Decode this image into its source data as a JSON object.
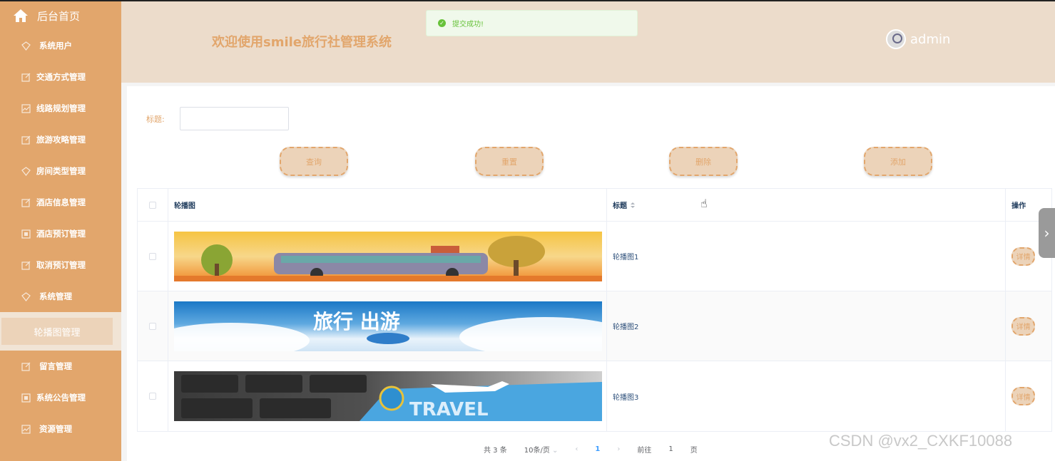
{
  "sidebar": {
    "home_label": "后台首页",
    "items": [
      {
        "label": "系统用户",
        "icon": "diamond-icon"
      },
      {
        "label": "交通方式管理",
        "icon": "edit-icon"
      },
      {
        "label": "线路规划管理",
        "icon": "chart-icon"
      },
      {
        "label": "旅游攻略管理",
        "icon": "edit-icon"
      },
      {
        "label": "房间类型管理",
        "icon": "diamond-icon"
      },
      {
        "label": "酒店信息管理",
        "icon": "edit-icon"
      },
      {
        "label": "酒店预订管理",
        "icon": "doc-icon"
      },
      {
        "label": "取消预订管理",
        "icon": "edit-icon"
      },
      {
        "label": "系统管理",
        "icon": "diamond-icon"
      }
    ],
    "active_label": "轮播图管理",
    "items_after": [
      {
        "label": "留言管理",
        "icon": "edit-icon"
      },
      {
        "label": "系统公告管理",
        "icon": "doc-icon"
      },
      {
        "label": "资源管理",
        "icon": "chart-icon"
      }
    ]
  },
  "header": {
    "title": "欢迎使用smile旅行社管理系统",
    "username": "admin"
  },
  "toast": {
    "message": "提交成功!"
  },
  "search": {
    "label": "标题:",
    "value": ""
  },
  "buttons": {
    "query": "查询",
    "reset": "重置",
    "delete": "删除",
    "add": "添加"
  },
  "table": {
    "headers": {
      "image": "轮播图",
      "title": "标题",
      "op": "操作"
    },
    "rows": [
      {
        "title": "轮播图1",
        "detail": "详情"
      },
      {
        "title": "轮播图2",
        "detail": "详情"
      },
      {
        "title": "轮播图3",
        "detail": "详情"
      }
    ]
  },
  "pager": {
    "total": "共 3 条",
    "page_size": "10条/页",
    "current": "1",
    "goto_prefix": "前往",
    "goto_value": "1",
    "goto_suffix": "页"
  },
  "banner2_text": "旅行 出游",
  "banner3_text": "TRAVEL",
  "watermark": "CSDN @vx2_CXKF10088",
  "colors": {
    "accent": "#e2a66c",
    "header_bg": "#ecdccb",
    "success": "#67c23a"
  }
}
